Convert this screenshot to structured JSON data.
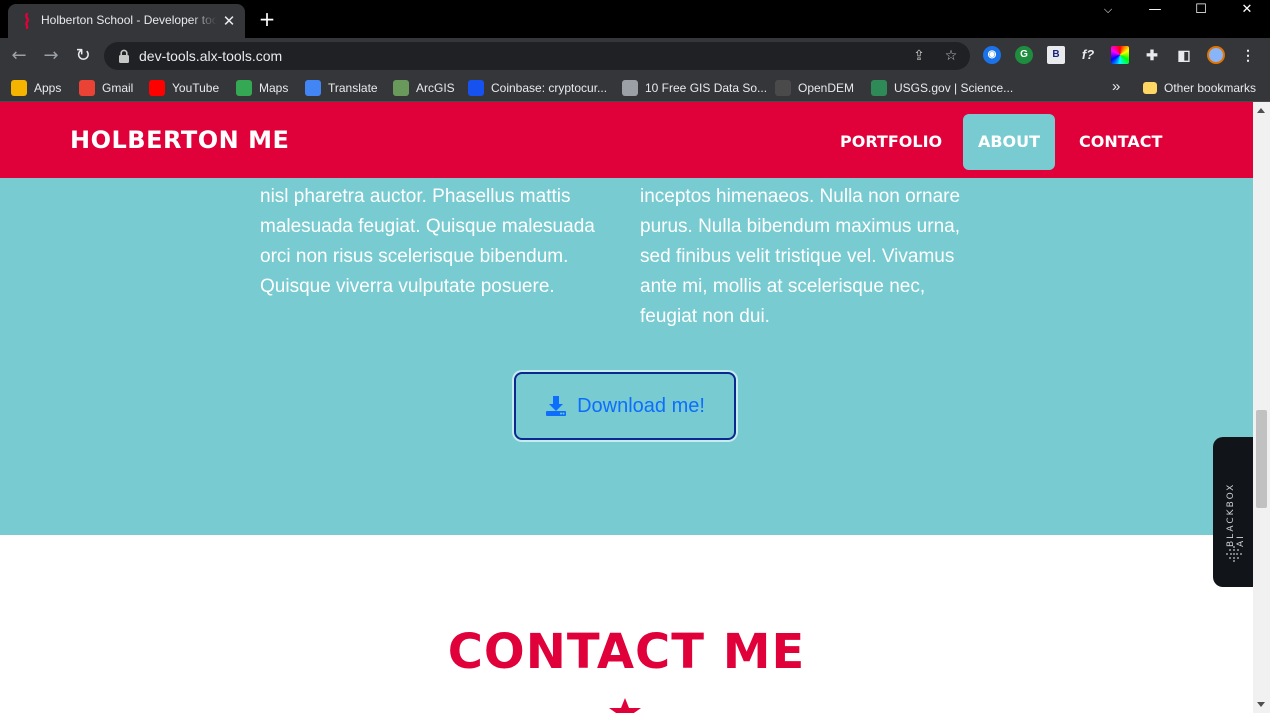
{
  "browser": {
    "tab_title": "Holberton School - Developer tools",
    "url": "dev-tools.alx-tools.com",
    "bookmarks": [
      {
        "label": "Apps",
        "icon": "apps-grid-icon",
        "color": "#f4b400"
      },
      {
        "label": "Gmail",
        "icon": "gmail-icon",
        "color": "#ea4335"
      },
      {
        "label": "YouTube",
        "icon": "youtube-icon",
        "color": "#ff0000"
      },
      {
        "label": "Maps",
        "icon": "maps-pin-icon",
        "color": "#34a853"
      },
      {
        "label": "Translate",
        "icon": "translate-icon",
        "color": "#4285f4"
      },
      {
        "label": "ArcGIS",
        "icon": "arcgis-globe-icon",
        "color": "#6a9a5b"
      },
      {
        "label": "Coinbase: cryptocur...",
        "icon": "coinbase-icon",
        "color": "#1652f0"
      },
      {
        "label": "10 Free GIS Data So...",
        "icon": "gis-icon",
        "color": "#9aa0a6"
      },
      {
        "label": "OpenDEM",
        "icon": "opendem-icon",
        "color": "#4a4a4a"
      },
      {
        "label": "USGS.gov | Science...",
        "icon": "usgs-icon",
        "color": "#2e8b57"
      }
    ],
    "overflow_label": "»",
    "other_bookmarks": "Other bookmarks"
  },
  "site": {
    "brand": "HOLBERTON ME",
    "nav": [
      {
        "label": "PORTFOLIO",
        "active": false
      },
      {
        "label": "ABOUT",
        "active": true
      },
      {
        "label": "CONTACT",
        "active": false
      }
    ],
    "about": {
      "left_column": "nisl pharetra auctor. Phasellus mattis malesuada feugiat. Quisque malesuada orci non risus scelerisque bibendum. Quisque viverra vulputate posuere.",
      "right_column": "inceptos himenaeos. Nulla non ornare purus. Nulla bibendum maximus urna, sed finibus velit tristique vel. Vivamus ante mi, mollis at scelerisque nec, feugiat non dui.",
      "download_label": "Download me!"
    },
    "contact_title": "CONTACT ME"
  },
  "blackbox_label": "BLACKBOX AI",
  "colors": {
    "brand_red": "#e0003a",
    "teal": "#78ccd1",
    "link_blue": "#0d6efd"
  }
}
